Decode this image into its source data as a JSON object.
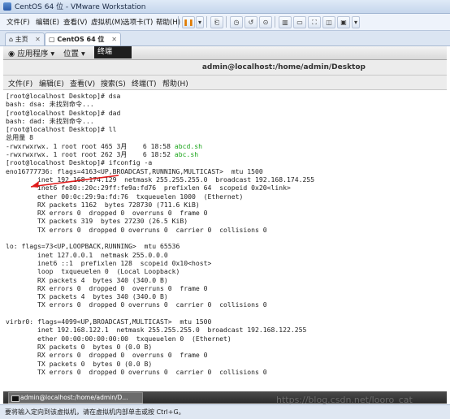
{
  "window": {
    "title": "CentOS 64 位 - VMware Workstation"
  },
  "vm_menu": {
    "file": "文件(F)",
    "edit": "编辑(E)",
    "view": "查看(V)",
    "vm": "虚拟机(M)",
    "tabs": "选项卡(T)",
    "help": "帮助(H)"
  },
  "vm_tabs": [
    {
      "label": "主页"
    },
    {
      "label": "CentOS 64 位"
    }
  ],
  "gnome": {
    "applications": "应用程序",
    "places": "位置",
    "terminal": "终端"
  },
  "terminal": {
    "title": "admin@localhost:/home/admin/Desktop",
    "menu": [
      "文件(F)",
      "编辑(E)",
      "查看(V)",
      "搜索(S)",
      "终端(T)",
      "帮助(H)"
    ],
    "lines": [
      "[root@localhost Desktop]# dsa",
      "bash: dsa: 未找到命令...",
      "[root@localhost Desktop]# dad",
      "bash: dad: 未找到命令...",
      "[root@localhost Desktop]# ll",
      "总用量 8"
    ],
    "ls_1_prefix": "-rwxrwxrwx. 1 root root 465 3月    6 18:58 ",
    "ls_1_file": "abcd.sh",
    "ls_2_prefix": "-rwxrwxrwx. 1 root root 262 3月    6 18:52 ",
    "ls_2_file": "abc.sh",
    "output": [
      "[root@localhost Desktop]# ifconfig -a",
      "eno16777736: flags=4163<UP,BROADCAST,RUNNING,MULTICAST>  mtu 1500",
      "        inet 192.168.174.129  netmask 255.255.255.0  broadcast 192.168.174.255",
      "        inet6 fe80::20c:29ff:fe9a:fd76  prefixlen 64  scopeid 0x20<link>",
      "        ether 00:0c:29:9a:fd:76  txqueuelen 1000  (Ethernet)",
      "        RX packets 1162  bytes 728730 (711.6 KiB)",
      "        RX errors 0  dropped 0  overruns 0  frame 0",
      "        TX packets 319  bytes 27230 (26.5 KiB)",
      "        TX errors 0  dropped 0 overruns 0  carrier 0  collisions 0",
      "",
      "lo: flags=73<UP,LOOPBACK,RUNNING>  mtu 65536",
      "        inet 127.0.0.1  netmask 255.0.0.0",
      "        inet6 ::1  prefixlen 128  scopeid 0x10<host>",
      "        loop  txqueuelen 0  (Local Loopback)",
      "        RX packets 4  bytes 340 (340.0 B)",
      "        RX errors 0  dropped 0  overruns 0  frame 0",
      "        TX packets 4  bytes 340 (340.0 B)",
      "        TX errors 0  dropped 0 overruns 0  carrier 0  collisions 0",
      "",
      "virbr0: flags=4099<UP,BROADCAST,MULTICAST>  mtu 1500",
      "        inet 192.168.122.1  netmask 255.255.255.0  broadcast 192.168.122.255",
      "        ether 00:00:00:00:00:00  txqueuelen 0  (Ethernet)",
      "        RX packets 0  bytes 0 (0.0 B)",
      "        RX errors 0  dropped 0  overruns 0  frame 0",
      "        TX packets 0  bytes 0 (0.0 B)",
      "        TX errors 0  dropped 0 overruns 0  carrier 0  collisions 0"
    ]
  },
  "taskbar": {
    "task": "admin@localhost:/home/admin/D..."
  },
  "status_bar": {
    "text": "要将输入定向到该虚拟机，请在虚拟机内部单击或按 Ctrl+G。"
  },
  "watermark": "https://blog.csdn.net/looro_cat",
  "colors": {
    "file_green": "#1ba51b",
    "arrow_red": "#e01b1b"
  }
}
